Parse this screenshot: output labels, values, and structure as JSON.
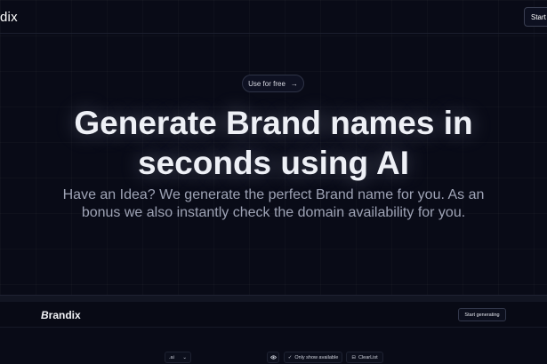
{
  "header": {
    "brand_partial": "dix",
    "start_button_label": "Start"
  },
  "hero": {
    "pill_label": "Use for free",
    "pill_arrow": "→",
    "headline_line1": "Generate Brand names in",
    "headline_line2": "seconds using AI",
    "subtext_line1": "Have an Idea? We generate the perfect Brand name for you. As an",
    "subtext_line2": "bonus we also instantly check the domain availability for you."
  },
  "app": {
    "logo_initial": "B",
    "logo_rest": "randix",
    "start_generating_label": "Start generating"
  },
  "toolbar": {
    "tld_value": ".ai",
    "tld_chevron": "⌄",
    "eye_icon": "eye-icon",
    "only_available_check": "✓",
    "only_available_label": "Only show available",
    "clear_icon": "⊟",
    "clear_label": "ClearList"
  },
  "colors": {
    "background": "#090b17",
    "headline": "#eef0f6",
    "subtext": "#9ea3b5"
  }
}
